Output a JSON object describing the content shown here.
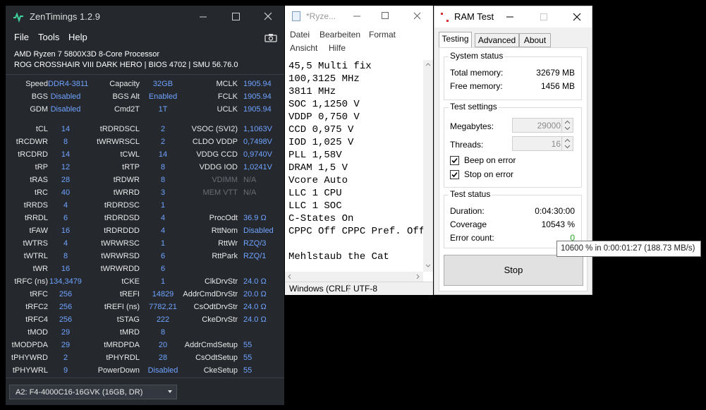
{
  "zentimings": {
    "title": "ZenTimings 1.2.9",
    "menu": [
      "File",
      "Tools",
      "Help"
    ],
    "cpu": "AMD Ryzen 7 5800X3D 8-Core Processor",
    "board": "ROG CROSSHAIR VIII DARK HERO | BIOS 4702 | SMU 56.76.0",
    "top_rows": [
      [
        {
          "l": "Speed",
          "v": "DDR4-3811"
        },
        {
          "l": "Capacity",
          "v": "32GB"
        },
        {
          "l": "MCLK",
          "v": "1905.94"
        }
      ],
      [
        {
          "l": "BGS",
          "v": "Disabled"
        },
        {
          "l": "BGS Alt",
          "v": "Enabled"
        },
        {
          "l": "FCLK",
          "v": "1905.94"
        }
      ],
      [
        {
          "l": "GDM",
          "v": "Disabled"
        },
        {
          "l": "Cmd2T",
          "v": "1T"
        },
        {
          "l": "UCLK",
          "v": "1905.94"
        }
      ]
    ],
    "rows": [
      [
        {
          "l": "tCL",
          "v": "14"
        },
        {
          "l": "tRDRDSCL",
          "v": "2"
        },
        {
          "l": "VSOC (SVI2)",
          "v": "1,1063V"
        }
      ],
      [
        {
          "l": "tRCDWR",
          "v": "8"
        },
        {
          "l": "tWRWRSCL",
          "v": "2"
        },
        {
          "l": "CLDO VDDP",
          "v": "0,7498V"
        }
      ],
      [
        {
          "l": "tRCDRD",
          "v": "14"
        },
        {
          "l": "tCWL",
          "v": "14"
        },
        {
          "l": "VDDG CCD",
          "v": "0,9740V"
        }
      ],
      [
        {
          "l": "tRP",
          "v": "12"
        },
        {
          "l": "tRTP",
          "v": "8"
        },
        {
          "l": "VDDG IOD",
          "v": "1,0241V"
        }
      ],
      [
        {
          "l": "tRAS",
          "v": "28"
        },
        {
          "l": "tRDWR",
          "v": "8"
        },
        {
          "l": "VDIMM",
          "v": "N/A",
          "dim": true
        }
      ],
      [
        {
          "l": "tRC",
          "v": "40"
        },
        {
          "l": "tWRRD",
          "v": "3"
        },
        {
          "l": "MEM VTT",
          "v": "N/A",
          "dim": true
        }
      ],
      [
        {
          "l": "tRRDS",
          "v": "4"
        },
        {
          "l": "tRDRDSC",
          "v": "1"
        },
        {
          "l": "",
          "v": ""
        }
      ],
      [
        {
          "l": "tRRDL",
          "v": "6"
        },
        {
          "l": "tRDRDSD",
          "v": "4"
        },
        {
          "l": "ProcOdt",
          "v": "36.9 Ω"
        }
      ],
      [
        {
          "l": "tFAW",
          "v": "16"
        },
        {
          "l": "tRDRDDD",
          "v": "4"
        },
        {
          "l": "RttNom",
          "v": "Disabled"
        }
      ],
      [
        {
          "l": "tWTRS",
          "v": "4"
        },
        {
          "l": "tWRWRSC",
          "v": "1"
        },
        {
          "l": "RttWr",
          "v": "RZQ/3"
        }
      ],
      [
        {
          "l": "tWTRL",
          "v": "8"
        },
        {
          "l": "tWRWRSD",
          "v": "6"
        },
        {
          "l": "RttPark",
          "v": "RZQ/1"
        }
      ],
      [
        {
          "l": "tWR",
          "v": "16"
        },
        {
          "l": "tWRWRDD",
          "v": "6"
        },
        {
          "l": "",
          "v": ""
        }
      ],
      [
        {
          "l": "tRFC (ns)",
          "v": "134,3479"
        },
        {
          "l": "tCKE",
          "v": "1"
        },
        {
          "l": "ClkDrvStr",
          "v": "24.0 Ω"
        }
      ],
      [
        {
          "l": "tRFC",
          "v": "256"
        },
        {
          "l": "tREFI",
          "v": "14829"
        },
        {
          "l": "AddrCmdDrvStr",
          "v": "20.0 Ω"
        }
      ],
      [
        {
          "l": "tRFC2",
          "v": "256"
        },
        {
          "l": "tREFI (ns)",
          "v": "7782,21"
        },
        {
          "l": "CsOdtDrvStr",
          "v": "24.0 Ω"
        }
      ],
      [
        {
          "l": "tRFC4",
          "v": "256"
        },
        {
          "l": "tSTAG",
          "v": "222"
        },
        {
          "l": "CkeDrvStr",
          "v": "24.0 Ω"
        }
      ],
      [
        {
          "l": "tMOD",
          "v": "29"
        },
        {
          "l": "tMRD",
          "v": "8"
        },
        {
          "l": "",
          "v": ""
        }
      ],
      [
        {
          "l": "tMODPDA",
          "v": "29"
        },
        {
          "l": "tMRDPDA",
          "v": "20"
        },
        {
          "l": "AddrCmdSetup",
          "v": "55"
        }
      ],
      [
        {
          "l": "tPHYWRD",
          "v": "2"
        },
        {
          "l": "tPHYRDL",
          "v": "28"
        },
        {
          "l": "CsOdtSetup",
          "v": "55"
        }
      ],
      [
        {
          "l": "tPHYWRL",
          "v": "9"
        },
        {
          "l": "PowerDown",
          "v": "Disabled"
        },
        {
          "l": "CkeSetup",
          "v": "55"
        }
      ]
    ],
    "dimm_select": "A2: F4-4000C16-16GVK (16GB, DR)",
    "colors": {
      "bg": "#25282d",
      "value": "#6fa3ff",
      "label": "#e8e8e8"
    }
  },
  "notepad": {
    "title": "*Ryze...",
    "menu": [
      "Datei",
      "Bearbeiten",
      "Format",
      "Ansicht",
      "Hilfe"
    ],
    "lines": [
      "45,5 Multi fix",
      "100,3125 MHz",
      "3811 MHz",
      "SOC 1,1250 V",
      "VDDP 0,750 V",
      "CCD 0,975 V",
      "IOD 1,025 V",
      "PLL 1,58V",
      "DRAM 1,5 V",
      "Vcore Auto",
      "LLC 1 CPU",
      "LLC 1 SOC",
      "C-States On",
      "CPPC Off CPPC Pref. Off",
      "",
      "Mehlstaub the Cat"
    ],
    "status_eol": "Windows (CRLF",
    "status_enc": "UTF-8"
  },
  "ramtest": {
    "title": "RAM Test",
    "tabs": [
      "Testing",
      "Advanced",
      "About"
    ],
    "system_status": {
      "title": "System status",
      "total_label": "Total memory:",
      "total_value": "32679 MB",
      "free_label": "Free memory:",
      "free_value": "1456 MB"
    },
    "test_settings": {
      "title": "Test settings",
      "mb_label": "Megabytes:",
      "mb_value": "29000",
      "threads_label": "Threads:",
      "threads_value": "16",
      "beep_label": "Beep on error",
      "stop_label": "Stop on error"
    },
    "test_status": {
      "title": "Test status",
      "duration_label": "Duration:",
      "duration_value": "0:04:30:00",
      "coverage_label": "Coverage",
      "coverage_value": "10543 %",
      "errors_label": "Error count:",
      "errors_value": "0"
    },
    "stop_label": "Stop",
    "tooltip": "10600 % in 0:00:01:27 (188.73 MB/s)"
  }
}
